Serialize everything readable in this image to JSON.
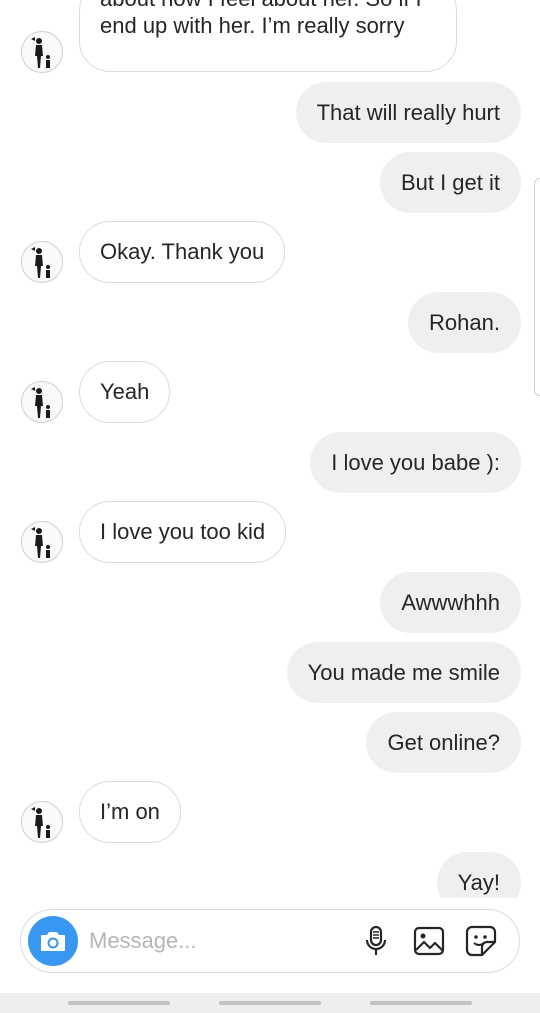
{
  "messages": [
    {
      "dir": "in",
      "avatar": true,
      "lines": [
        "about how I feel about her. So if I",
        "end up with her. I’m really sorry"
      ]
    },
    {
      "dir": "out",
      "text": "That will really hurt"
    },
    {
      "dir": "out",
      "text": "But I get it"
    },
    {
      "dir": "in",
      "avatar": true,
      "text": "Okay. Thank you"
    },
    {
      "dir": "out",
      "text": "Rohan."
    },
    {
      "dir": "in",
      "avatar": true,
      "text": "Yeah"
    },
    {
      "dir": "out",
      "text": "I love you babe ):"
    },
    {
      "dir": "in",
      "avatar": true,
      "text": "I love you too kid"
    },
    {
      "dir": "out",
      "text": "Awwwhhh"
    },
    {
      "dir": "out",
      "text": "You made me smile"
    },
    {
      "dir": "out",
      "text": "Get online?"
    },
    {
      "dir": "in",
      "avatar": true,
      "text": "I’m on"
    },
    {
      "dir": "out",
      "text": "Yay!"
    }
  ],
  "composer": {
    "placeholder": "Message...",
    "icons": [
      "camera-icon",
      "microphone-icon",
      "gallery-icon",
      "sticker-icon"
    ]
  },
  "colors": {
    "accent": "#3897f0",
    "outgoing_bubble": "#efefef",
    "incoming_border": "#dbdbdb",
    "text": "#262626",
    "placeholder": "#b5b5b5"
  }
}
